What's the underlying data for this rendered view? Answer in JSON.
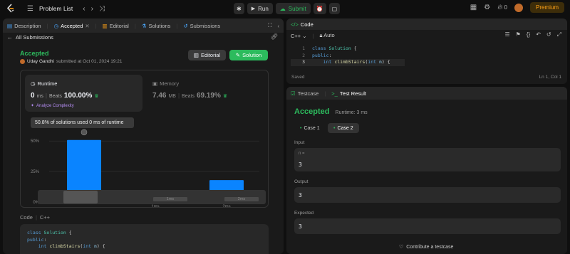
{
  "topbar": {
    "problem_list": "Problem List",
    "run": "Run",
    "submit": "Submit",
    "fire_count": "0",
    "premium": "Premium"
  },
  "left": {
    "tabs": [
      {
        "label": "Description"
      },
      {
        "label": "Accepted"
      },
      {
        "label": "Editorial"
      },
      {
        "label": "Solutions"
      },
      {
        "label": "Submissions"
      }
    ],
    "back": "All Submissions",
    "status": "Accepted",
    "user": "Uday Gandhi",
    "submitted": "submitted at Oct 01, 2024 19:21",
    "editorial_btn": "Editorial",
    "solution_btn": "Solution",
    "runtime": {
      "title": "Runtime",
      "value": "0",
      "unit": "ms",
      "beats_label": "Beats",
      "beats": "100.00%",
      "analyze": "Analyze Complexity"
    },
    "memory": {
      "title": "Memory",
      "value": "7.46",
      "unit": "MB",
      "beats_label": "Beats",
      "beats": "69.19%"
    },
    "tooltip": "50.8% of solutions used 0 ms of runtime",
    "code_label": "Code",
    "lang": "C++",
    "code_lines": [
      "class Solution {",
      "public:",
      "    int climbStairs(int n) {"
    ]
  },
  "chart_data": {
    "type": "bar",
    "categories": [
      "0ms",
      "1ms",
      "2ms"
    ],
    "values": [
      50.8,
      2.5,
      18
    ],
    "yticks": [
      "50%",
      "25%",
      "0%"
    ],
    "ylim": [
      0,
      60
    ],
    "xlabels": [
      "",
      "1ms",
      "2ms"
    ],
    "minimap_labels": [
      "1ms",
      "2ms"
    ]
  },
  "editor": {
    "title": "Code",
    "lang": "C++",
    "mode": "Auto",
    "lines": [
      {
        "n": "1",
        "t": "class Solution {"
      },
      {
        "n": "2",
        "t": "public:"
      },
      {
        "n": "3",
        "t": "    int climbStairs(int n) {"
      }
    ],
    "saved": "Saved",
    "position": "Ln 1, Col 1"
  },
  "result": {
    "tab_testcase": "Testcase",
    "tab_result": "Test Result",
    "status": "Accepted",
    "runtime": "Runtime: 3 ms",
    "cases": [
      "Case 1",
      "Case 2"
    ],
    "input_label": "Input",
    "input_var": "n =",
    "input_val": "3",
    "output_label": "Output",
    "output_val": "3",
    "expected_label": "Expected",
    "expected_val": "3",
    "contribute": "Contribute a testcase"
  }
}
